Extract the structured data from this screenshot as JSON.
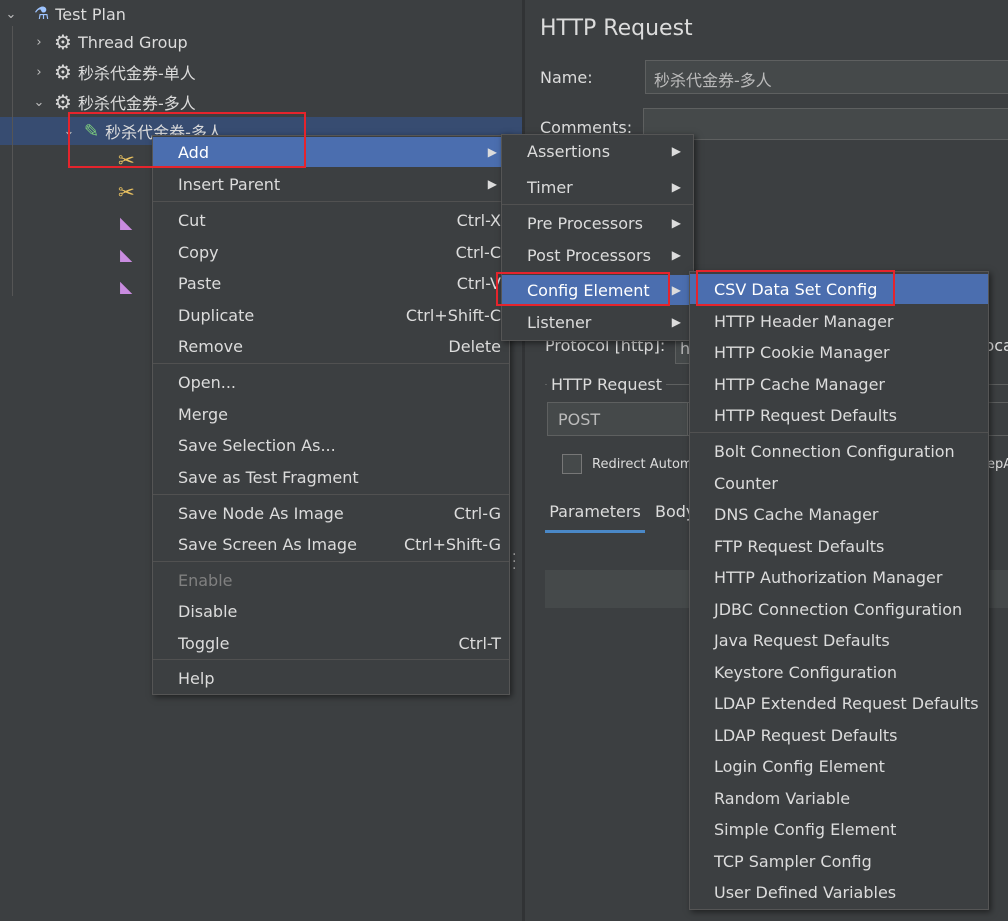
{
  "tree": {
    "items": [
      {
        "label": "Test Plan"
      },
      {
        "label": "Thread Group"
      },
      {
        "label": "秒杀代金券-单人"
      },
      {
        "label": "秒杀代金券-多人"
      },
      {
        "label": "秒杀代金券-多人"
      }
    ]
  },
  "panel": {
    "title": "HTTP Request",
    "name_label": "Name:",
    "name_value": "秒杀代金券-多人",
    "comments_label": "Comments:",
    "protocol_label": "Protocol [http]:",
    "protocol_value": "h",
    "server_value_partial": "loca",
    "section_label": "HTTP Request",
    "method_value": "POST",
    "redirect_label": "Redirect Autom",
    "keepalive_partial": "epA",
    "tab_parameters": "Parameters",
    "tab_body": "Body"
  },
  "context_menu": {
    "items": [
      {
        "label": "Add",
        "shortcut": "",
        "submenu": true
      },
      {
        "label": "Insert Parent",
        "shortcut": "",
        "submenu": true
      },
      {
        "label": "Cut",
        "shortcut": "Ctrl-X"
      },
      {
        "label": "Copy",
        "shortcut": "Ctrl-C"
      },
      {
        "label": "Paste",
        "shortcut": "Ctrl-V"
      },
      {
        "label": "Duplicate",
        "shortcut": "Ctrl+Shift-C"
      },
      {
        "label": "Remove",
        "shortcut": "Delete"
      },
      {
        "label": "Open...",
        "shortcut": ""
      },
      {
        "label": "Merge",
        "shortcut": ""
      },
      {
        "label": "Save Selection As...",
        "shortcut": ""
      },
      {
        "label": "Save as Test Fragment",
        "shortcut": ""
      },
      {
        "label": "Save Node As Image",
        "shortcut": "Ctrl-G"
      },
      {
        "label": "Save Screen As Image",
        "shortcut": "Ctrl+Shift-G"
      },
      {
        "label": "Enable",
        "shortcut": ""
      },
      {
        "label": "Disable",
        "shortcut": ""
      },
      {
        "label": "Toggle",
        "shortcut": "Ctrl-T"
      },
      {
        "label": "Help",
        "shortcut": ""
      }
    ]
  },
  "add_submenu": {
    "items": [
      {
        "label": "Assertions"
      },
      {
        "label": "Timer"
      },
      {
        "label": "Pre Processors"
      },
      {
        "label": "Post Processors"
      },
      {
        "label": "Config Element"
      },
      {
        "label": "Listener"
      }
    ]
  },
  "config_submenu": {
    "items": [
      {
        "label": "CSV Data Set Config"
      },
      {
        "label": "HTTP Header Manager"
      },
      {
        "label": "HTTP Cookie Manager"
      },
      {
        "label": "HTTP Cache Manager"
      },
      {
        "label": "HTTP Request Defaults"
      },
      {
        "label": "Bolt Connection Configuration"
      },
      {
        "label": "Counter"
      },
      {
        "label": "DNS Cache Manager"
      },
      {
        "label": "FTP Request Defaults"
      },
      {
        "label": "HTTP Authorization Manager"
      },
      {
        "label": "JDBC Connection Configuration"
      },
      {
        "label": "Java Request Defaults"
      },
      {
        "label": "Keystore Configuration"
      },
      {
        "label": "LDAP Extended Request Defaults"
      },
      {
        "label": "LDAP Request Defaults"
      },
      {
        "label": "Login Config Element"
      },
      {
        "label": "Random Variable"
      },
      {
        "label": "Simple Config Element"
      },
      {
        "label": "TCP Sampler Config"
      },
      {
        "label": "User Defined Variables"
      }
    ]
  },
  "colors": {
    "background": "#3c3f41",
    "selection": "#4b6eaf",
    "highlight_border": "#e5242c"
  }
}
